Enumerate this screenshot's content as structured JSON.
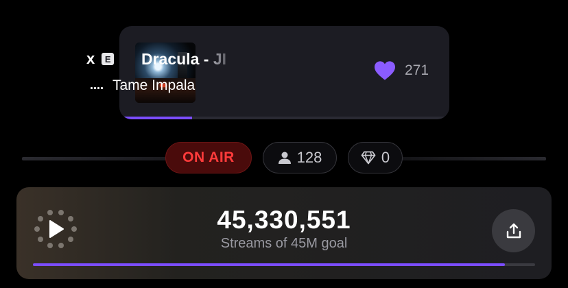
{
  "now_playing": {
    "short_title": "x",
    "explicit_badge": "E",
    "title": "Dracula - ",
    "title_suffix": "JI",
    "artist": "Tame Impala",
    "likes": "271",
    "track_progress": 0.22
  },
  "status": {
    "on_air_label": "ON AIR",
    "listeners": "128",
    "gems": "0"
  },
  "streams": {
    "count": "45,330,551",
    "goal_label": "Streams of 45M goal",
    "goal_progress": 0.94
  },
  "colors": {
    "accent": "#7b4dff",
    "on_air_text": "#ff3b3b",
    "on_air_bg": "#4a0b0b"
  },
  "icons": [
    "album-art",
    "explicit-icon",
    "equalizer-icon",
    "heart-icon",
    "user-icon",
    "diamond-icon",
    "play-icon",
    "loading-spinner-icon",
    "share-icon"
  ]
}
